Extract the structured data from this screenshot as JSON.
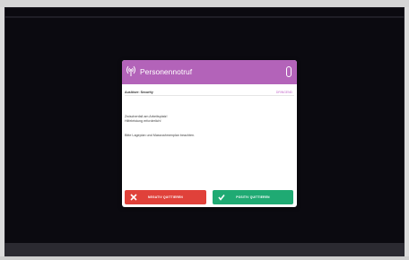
{
  "dialog": {
    "title": "Personennotruf",
    "subheader": "Auslöser: Security",
    "subheader_right": "DRINGEND",
    "message_lines": [
      "Zwischenfall am Arbeitsplatz!",
      "Hilfeleistung erforderlich!"
    ],
    "instruction": "Bitte Lageplan und Massnahmenplan beachten.",
    "negative_button": "NEGATIV QUITTIEREN",
    "positive_button": "POSITIV QUITTIEREN"
  },
  "colors": {
    "header": "#b363b9",
    "negative": "#e0413a",
    "positive": "#1faa73",
    "screen_bg": "#0b0a10"
  },
  "icons": {
    "header": "alarm-signal-icon",
    "header_button": "pill-toggle-icon",
    "negative": "close-icon",
    "positive": "checkmark-icon"
  }
}
